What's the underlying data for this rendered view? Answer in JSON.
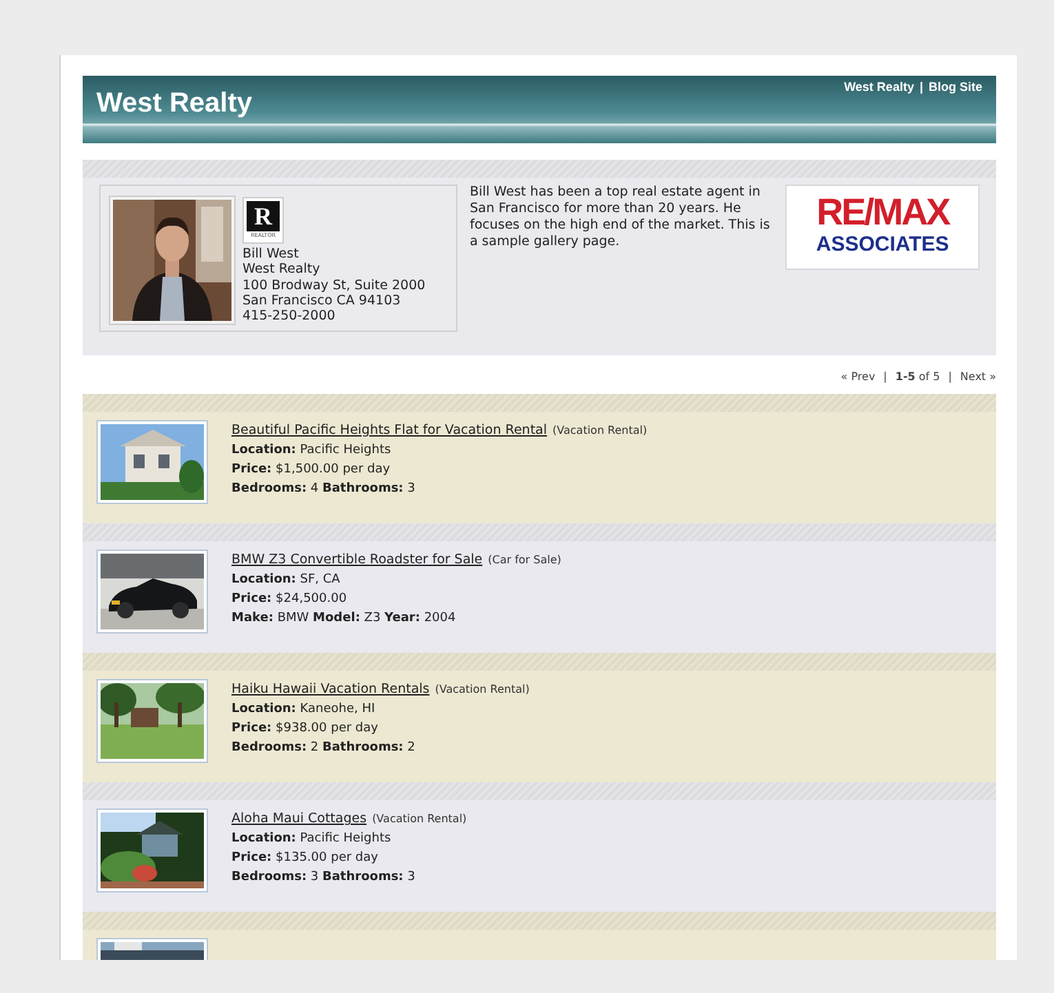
{
  "header": {
    "title": "West Realty",
    "links": [
      "West Realty",
      "Blog Site"
    ],
    "separator": "|"
  },
  "agent": {
    "badge": {
      "letter": "R",
      "caption": "REALTOR"
    },
    "lines": [
      "Bill West",
      "West Realty",
      "100 Brodway St, Suite 2000",
      "San Francisco CA 94103",
      "415-250-2000"
    ],
    "bio": "Bill West has been a top real estate agent in San Francisco for more than 20 years. He focuses on the high end of the market. This is a sample gallery page.",
    "logo": {
      "mark": "RE/MAX",
      "sub": "ASSOCIATES"
    }
  },
  "pager": {
    "prev": "« Prev",
    "separator": "|",
    "range": "**1-5** of 5",
    "next": "Next »"
  },
  "listings": [
    {
      "kind": "listing",
      "title": "Beautiful Pacific Heights Flat for Vacation Rental",
      "type": "(Vacation Rental)",
      "details": [
        "**Location:** Pacific Heights",
        "**Price:** $1,500.00 per day",
        "**Bedrooms:** 4 **Bathrooms:** 3"
      ]
    },
    {
      "kind": "listing",
      "title": "BMW Z3 Convertible Roadster for Sale",
      "type": "(Car for Sale)",
      "details": [
        "**Location:** SF, CA",
        "**Price:** $24,500.00",
        "**Make:** BMW **Model:** Z3 **Year:** 2004"
      ]
    },
    {
      "kind": "listing",
      "title": "Haiku Hawaii Vacation Rentals",
      "type": "(Vacation Rental)",
      "details": [
        "**Location:** Kaneohe, HI",
        "**Price:** $938.00 per day",
        "**Bedrooms:** 2 **Bathrooms:** 2"
      ]
    },
    {
      "kind": "listing",
      "title": "Aloha Maui Cottages",
      "type": "(Vacation Rental)",
      "details": [
        "**Location:** Pacific Heights",
        "**Price:** $135.00 per day",
        "**Bedrooms:** 3 **Bathrooms:** 3"
      ]
    },
    {
      "kind": "picture"
    }
  ]
}
